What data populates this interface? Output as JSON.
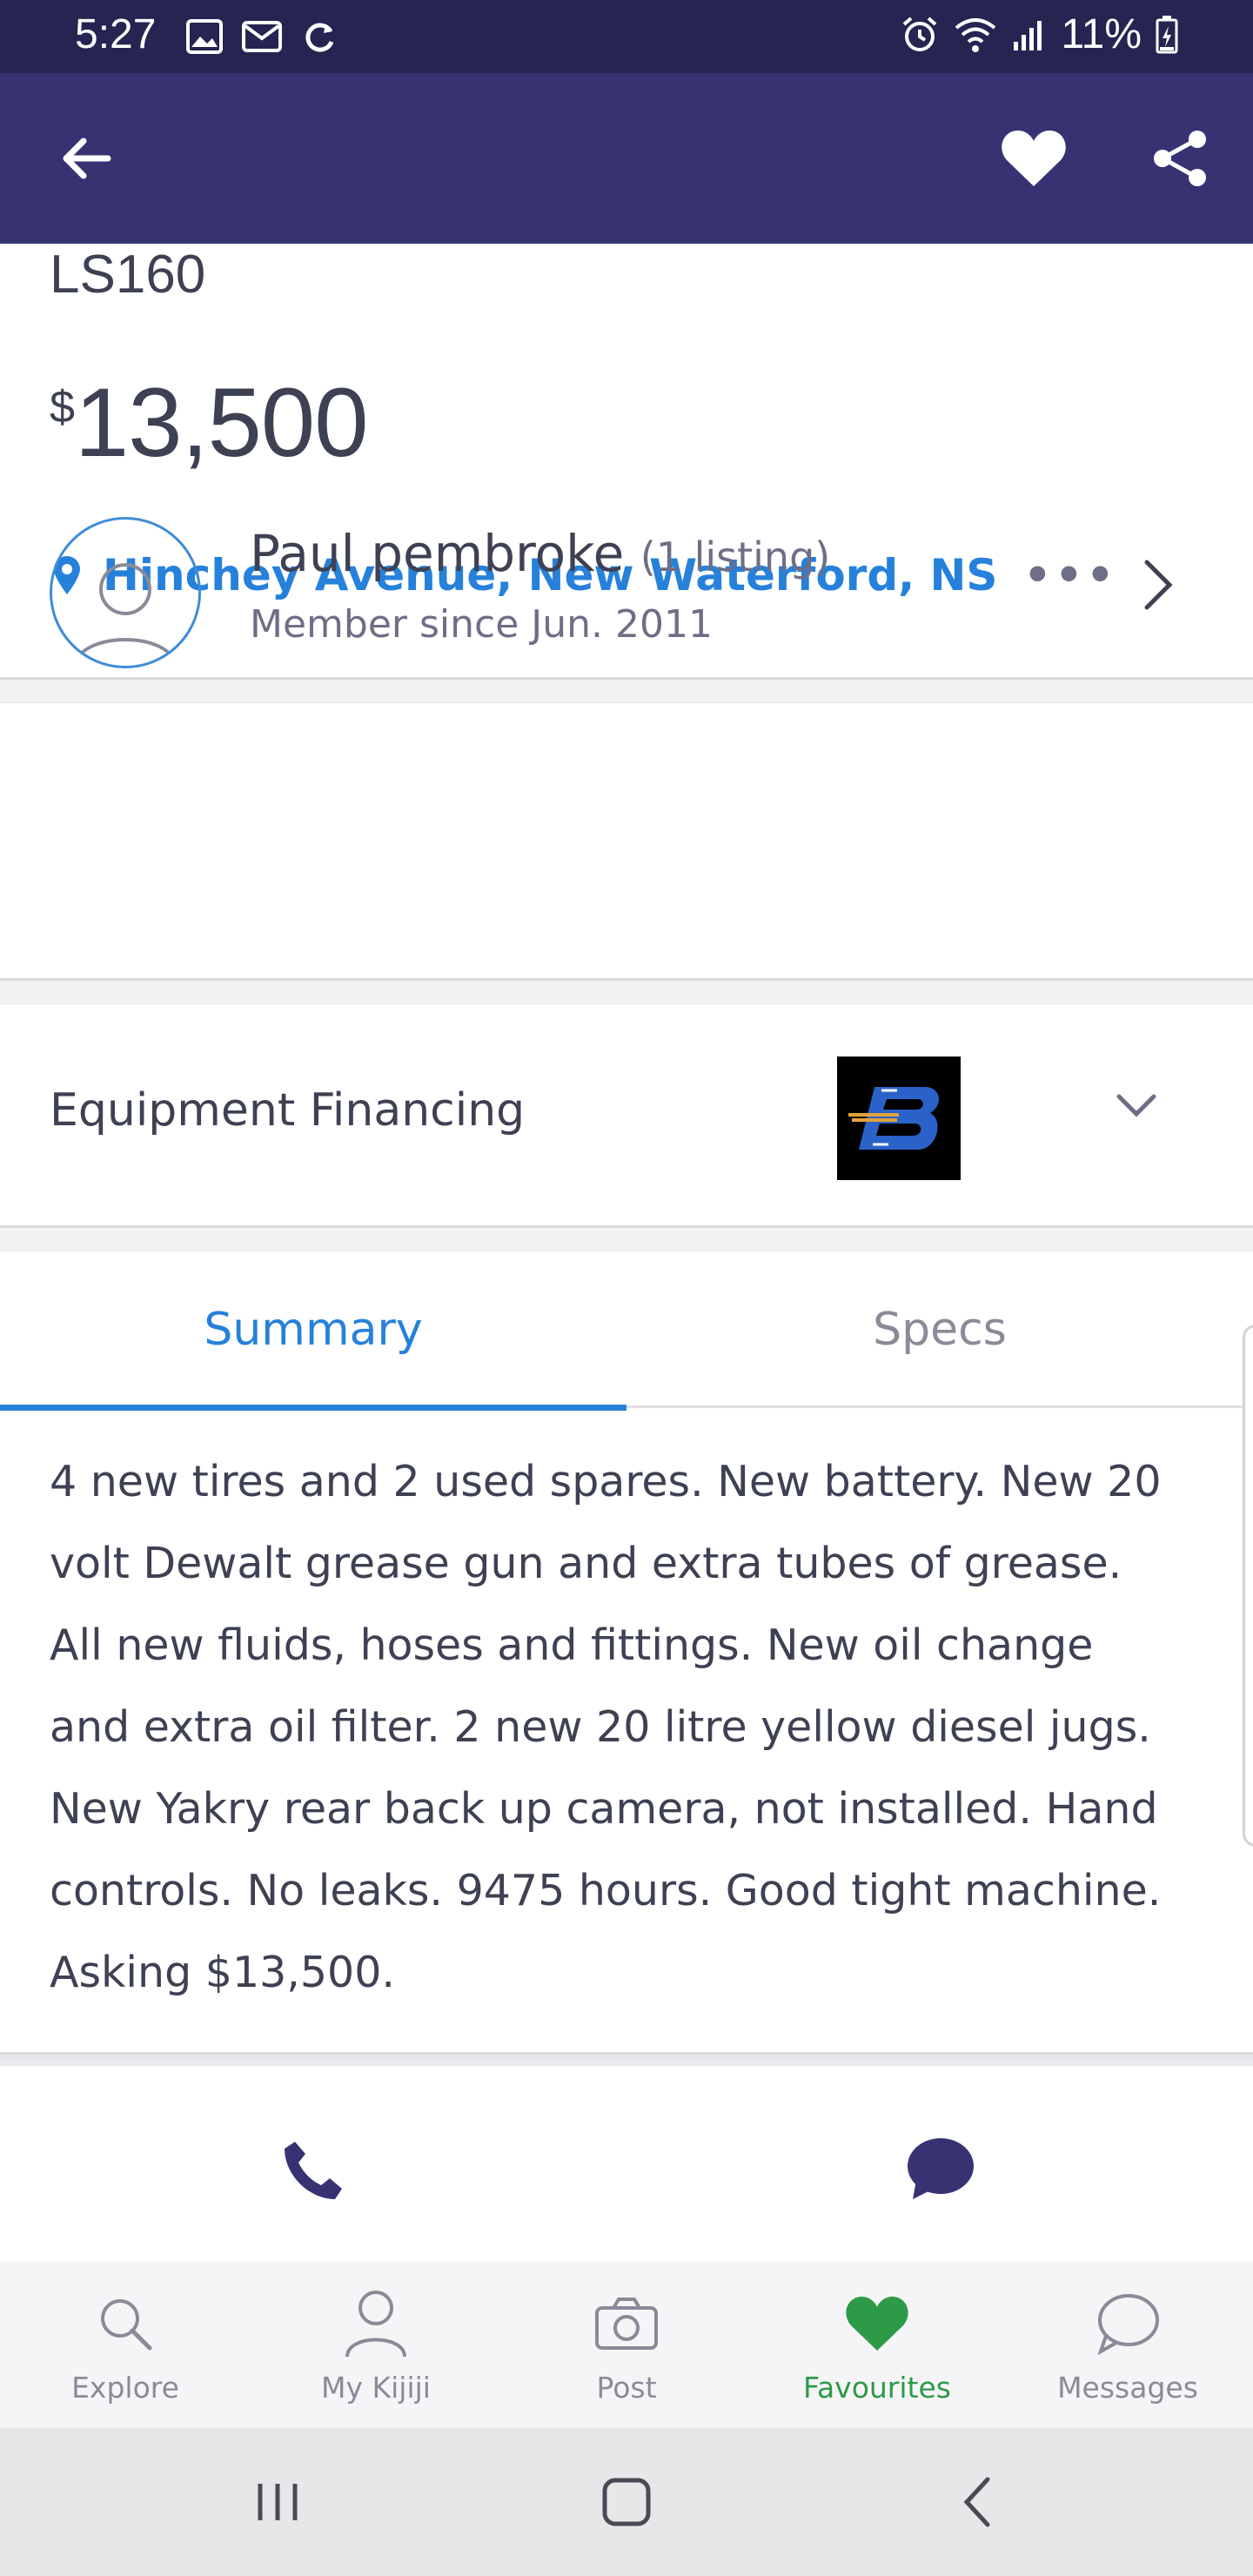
{
  "status_bar": {
    "time": "5:27",
    "battery": "11%"
  },
  "app_bar": {
    "back_icon": "arrow-left-icon",
    "favourite_icon": "heart-icon",
    "share_icon": "share-icon"
  },
  "listing": {
    "title": "LS160",
    "currency": "$",
    "price": "13,500",
    "location": "Hinchey Avenue, New Waterford, NS",
    "more": "•••"
  },
  "seller": {
    "name": "Paul pembroke",
    "listing_count": "(1 listing)",
    "member_since": "Member since Jun. 2011"
  },
  "financing": {
    "label": "Equipment Financing"
  },
  "tabs": [
    {
      "label": "Summary",
      "active": true
    },
    {
      "label": "Specs",
      "active": false
    }
  ],
  "description": "4 new tires and 2 used spares. New battery. New 20 volt Dewalt grease gun and extra tubes of grease. All new fluids, hoses and fittings. New oil change and extra oil filter. 2 new 20 litre yellow diesel jugs. New Yakry rear back up camera, not installed. Hand controls. No leaks. 9475 hours. Good tight machine. Asking $13,500.",
  "bottom_nav": [
    {
      "label": "Explore",
      "icon": "search-icon"
    },
    {
      "label": "My Kijiji",
      "icon": "person-icon"
    },
    {
      "label": "Post",
      "icon": "camera-icon"
    },
    {
      "label": "Favourites",
      "icon": "heart-icon",
      "active": true
    },
    {
      "label": "Messages",
      "icon": "chat-bubble-icon"
    }
  ],
  "colors": {
    "primary": "#373373",
    "status_bar": "#262451",
    "link": "#2681db",
    "active_nav": "#2d9a47"
  }
}
